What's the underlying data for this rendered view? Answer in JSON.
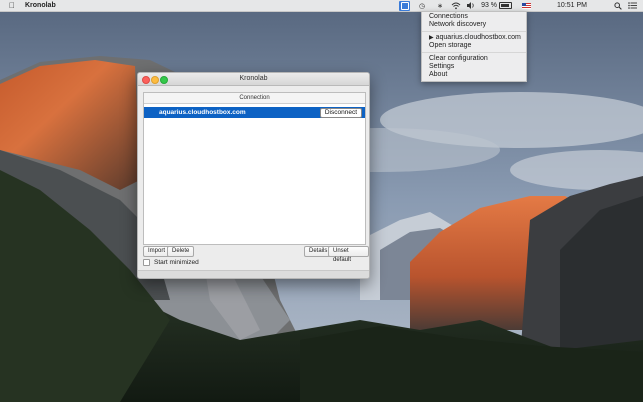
{
  "menubar": {
    "app_name": "Kronolab",
    "battery_percent": "93 %",
    "clock": "10:51 PM"
  },
  "dropdown": {
    "items": [
      "Connections",
      "Network discovery",
      "aquarius.cloudhostbox.com",
      "Open storage",
      "Clear configuration",
      "Settings",
      "About"
    ]
  },
  "window": {
    "title": "Kronolab",
    "pane_header": "Connection",
    "connection_host": "aquarius.cloudhostbox.com",
    "disconnect_label": "Disconnect",
    "import_label": "Import",
    "delete_label": "Delete",
    "details_label": "Details",
    "unset_default_label": "Unset default",
    "start_minimized_label": "Start minimized",
    "start_minimized_checked": false
  },
  "icons": {
    "apple": "apple-icon",
    "tray": "kronolab-tray-icon",
    "clock": "time-machine-icon",
    "bluetooth": "bluetooth-icon",
    "wifi": "wifi-icon",
    "volume": "volume-icon",
    "battery": "battery-icon",
    "flag": "us-flag-icon",
    "search": "spotlight-search-icon",
    "list": "notification-list-icon"
  },
  "colors": {
    "selection": "#0d62c4",
    "tray_active": "#3b7cd8"
  }
}
